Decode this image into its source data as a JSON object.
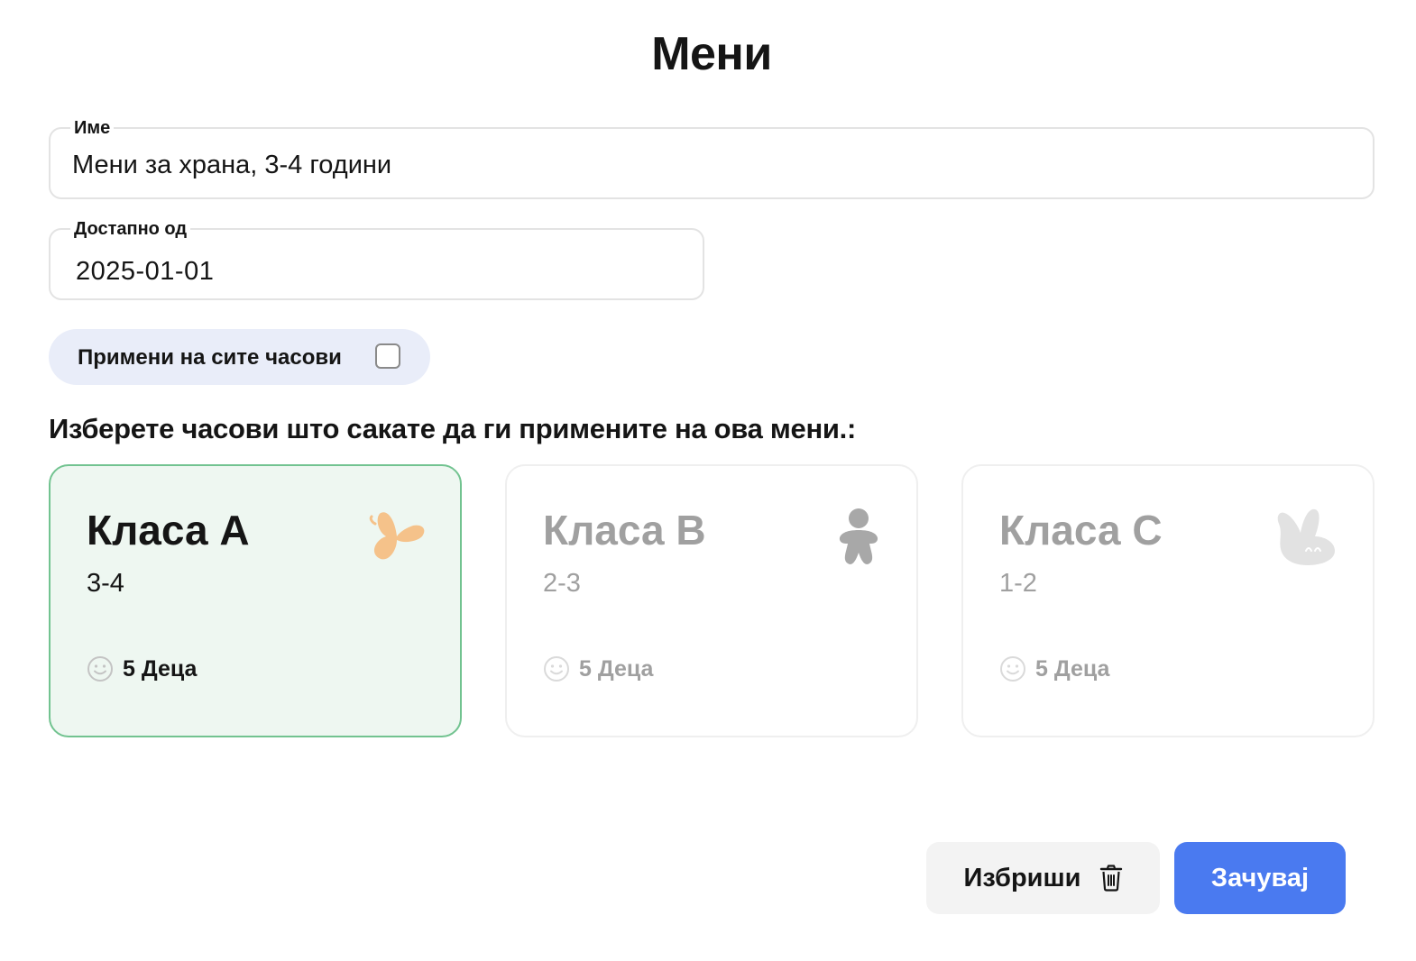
{
  "page": {
    "title": "Мени"
  },
  "form": {
    "name": {
      "label": "Име",
      "value": "Мени за храна, 3-4 години"
    },
    "available_from": {
      "label": "Достапно од",
      "value": "2025-01-01"
    },
    "apply_all": {
      "label": "Примени на сите часови",
      "checked": false
    }
  },
  "instruction": "Изберете часови што сакате да ги примените на ова мени.:",
  "classes": [
    {
      "name": "Класа А",
      "age": "3-4",
      "count": "5 Деца",
      "selected": true,
      "icon": "butterfly-icon",
      "icon_color": "#f5c28a"
    },
    {
      "name": "Класа B",
      "age": "2-3",
      "count": "5 Деца",
      "selected": false,
      "icon": "person-icon",
      "icon_color": "#a8a8a8"
    },
    {
      "name": "Класа C",
      "age": "1-2",
      "count": "5 Деца",
      "selected": false,
      "icon": "bunny-icon",
      "icon_color": "#e2e2e2"
    }
  ],
  "actions": {
    "delete_label": "Избриши",
    "save_label": "Зачувај"
  },
  "colors": {
    "accent": "#4a7af0",
    "selected_border": "#72c390",
    "selected_bg": "#eef7f1",
    "pill_bg": "#e9edf9"
  }
}
